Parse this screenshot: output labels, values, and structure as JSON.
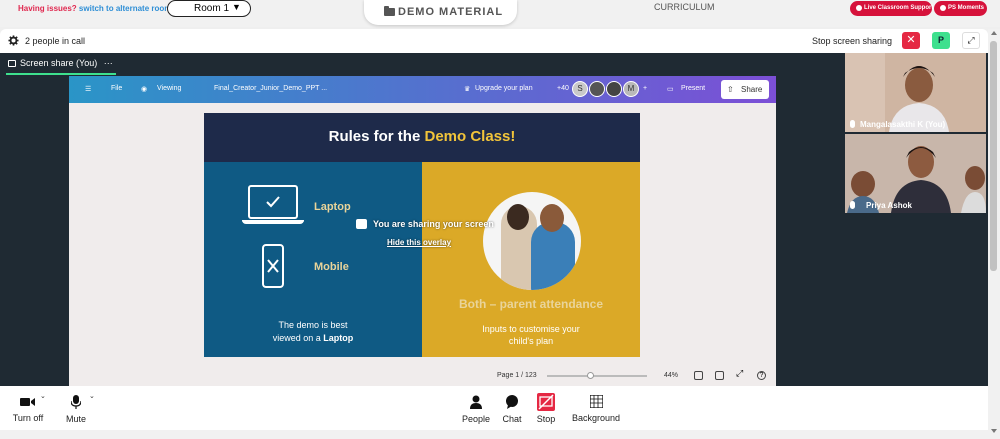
{
  "topbar": {
    "issue_q": "Having issues?",
    "issue_alt": "switch to alternate room",
    "room_label": "Room 1",
    "room_caret": "▼",
    "demo_material": "DEMO MATERIAL",
    "curriculum": "CURRICULUM",
    "support_label": "Live Classroom Support",
    "moments_label": "PS Moments",
    "accent": "#d6123b"
  },
  "callbar": {
    "people_count": "2 people in call",
    "stop_sharing": "Stop screen sharing",
    "close_glyph": "✕",
    "p_badge": "P",
    "expand_glyph": "⤢"
  },
  "share_tab": {
    "label": "Screen share (You)",
    "more": "···"
  },
  "canva": {
    "file": "File",
    "viewing": "Viewing",
    "doc_name": "Final_Creator_Junior_Demo_PPT ...",
    "upgrade": "Upgrade your plan",
    "count": "+40",
    "avatars": [
      "S",
      "",
      "",
      "M"
    ],
    "plus": "+",
    "present": "Present",
    "share": "Share"
  },
  "slide": {
    "title_pre": "Rules for the ",
    "title_hl": "Demo Class!",
    "laptop": "Laptop",
    "mobile": "Mobile",
    "demo_note_1": "The demo is best",
    "demo_note_2": "viewed on a ",
    "demo_note_bold": "Laptop",
    "both": "Both – parent attendance",
    "inputs_1": "Inputs to customise your",
    "inputs_2": "child's plan"
  },
  "overlay": {
    "sharing": "You are sharing your screen",
    "hide": "Hide this overlay"
  },
  "slide_footer": {
    "page": "Page 1 / 123",
    "zoom": "44%",
    "zoom_fraction": 0.44,
    "help": "?"
  },
  "participants": [
    {
      "name": "Mangalasakthi K (You)"
    },
    {
      "name": "Priya Ashok"
    }
  ],
  "toolbar": {
    "turn_off": "Turn off",
    "mute": "Mute",
    "people": "People",
    "chat": "Chat",
    "stop": "Stop",
    "background": "Background"
  }
}
